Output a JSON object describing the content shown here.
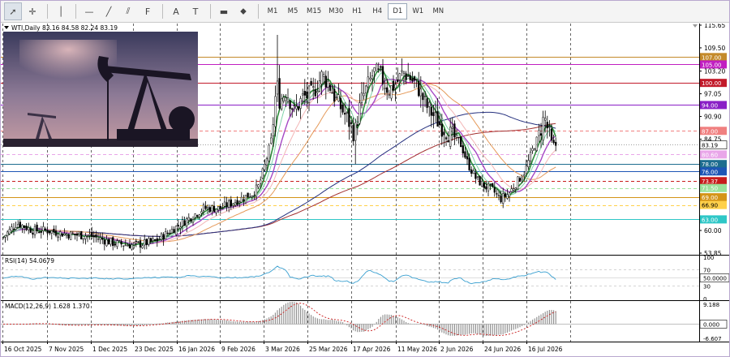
{
  "toolbar": {
    "tools": [
      {
        "name": "cursor-icon",
        "glyph": "➚"
      },
      {
        "name": "crosshair-icon",
        "glyph": "✛"
      },
      {
        "name": "vertical-line-icon",
        "glyph": "│"
      },
      {
        "name": "horizontal-line-icon",
        "glyph": "—"
      },
      {
        "name": "trendline-icon",
        "glyph": "╱"
      },
      {
        "name": "equidistant-channel-icon",
        "glyph": "⫽"
      },
      {
        "name": "fibonacci-icon",
        "glyph": "F"
      },
      {
        "name": "text-icon",
        "glyph": "A"
      },
      {
        "name": "text-label-icon",
        "glyph": "T"
      },
      {
        "name": "rectangle-icon",
        "glyph": "▬"
      },
      {
        "name": "shapes-menu-icon",
        "glyph": "⬥"
      }
    ],
    "timeframes": [
      "M1",
      "M5",
      "M15",
      "M30",
      "H1",
      "H4",
      "D1",
      "W1",
      "MN"
    ],
    "active_timeframe": "D1"
  },
  "chart": {
    "symbol_line": "WTI,Daily  83.16 84.58 82.24 83.19",
    "price_axis_labels": [
      "115.65",
      "109.50",
      "103.20",
      "97.05",
      "90.90",
      "84.75",
      "60.00",
      "53.85"
    ],
    "price_levels": [
      {
        "label": "107.00",
        "color": "#c48a2a",
        "text_color": "#ffffff"
      },
      {
        "label": "105.00",
        "color": "#c11fc1",
        "text_color": "#ffffff"
      },
      {
        "label": "100.00",
        "color": "#c21a2a",
        "text_color": "#ffffff"
      },
      {
        "label": "94.00",
        "color": "#8a1fc6",
        "text_color": "#ffffff"
      },
      {
        "label": "87.00",
        "color": "#f08080",
        "text_color": "#ffffff"
      },
      {
        "label": "83.19",
        "color": "#ffffff",
        "text_color": "#000000"
      },
      {
        "label": "80.60",
        "color": "#e9a6e9",
        "text_color": "#ffffff"
      },
      {
        "label": "78.00",
        "color": "#1e6d8f",
        "text_color": "#ffffff"
      },
      {
        "label": "76.00",
        "color": "#1e56b5",
        "text_color": "#ffffff"
      },
      {
        "label": "73.37",
        "color": "#c81c1c",
        "text_color": "#ffffff"
      },
      {
        "label": "71.50",
        "color": "#9be29b",
        "text_color": "#ffffff"
      },
      {
        "label": "69.00",
        "color": "#d49417",
        "text_color": "#ffffff"
      },
      {
        "label": "66.90",
        "color": "#ffd04a",
        "text_color": "#000000"
      },
      {
        "label": "63.00",
        "color": "#2ec7c7",
        "text_color": "#ffffff"
      }
    ],
    "date_labels": [
      "16 Oct 2025",
      "7 Nov 2025",
      "1 Dec 2025",
      "23 Dec 2025",
      "16 Jan 2026",
      "9 Feb 2026",
      "3 Mar 2026",
      "25 Mar 2026",
      "17 Apr 2026",
      "11 May 2026",
      "2 Jun 2026",
      "24 Jun 2026",
      "16 Jul 2026"
    ],
    "image_description": "oil pumpjack at dusk"
  },
  "rsi": {
    "title": "RSI(14) 54.0679",
    "axis_labels": [
      "100",
      "70",
      "50.0000",
      "30",
      "0"
    ]
  },
  "macd": {
    "title": "MACD(12,26,9) 1.628 1.370",
    "axis_labels": [
      "9.188",
      "0.000",
      "-6.607"
    ]
  },
  "colors": {
    "grid_line": "#000000",
    "ma_fast": "#2e8b3a",
    "ma_med": "#a648c4",
    "ma_slow": "#e59a5a",
    "ma_200": "#25307e",
    "ma_long_red": "#a23030",
    "rsi_line": "#3aa0d0",
    "macd_hist": "#8a8a8a",
    "macd_signal": "#c81c1c"
  }
}
